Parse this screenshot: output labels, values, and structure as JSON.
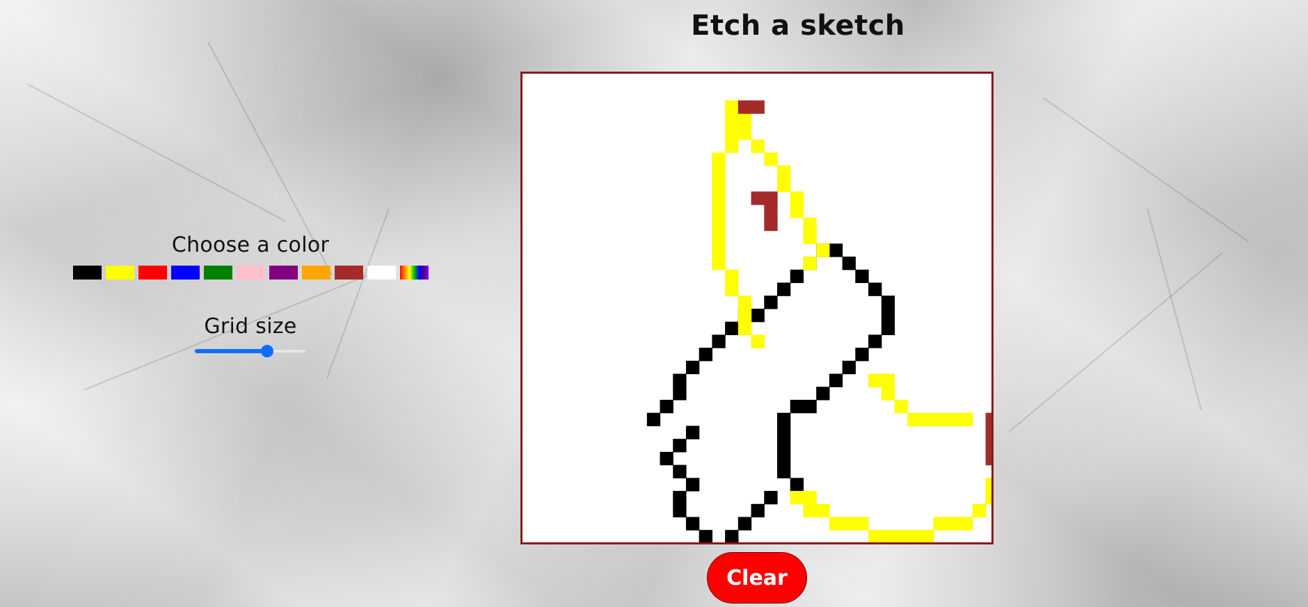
{
  "title": "Etch a sketch",
  "controls": {
    "color_heading": "Choose a color",
    "grid_heading": "Grid size",
    "grid_size_fraction": 0.65,
    "palette": [
      {
        "name": "black",
        "color": "#000000"
      },
      {
        "name": "yellow",
        "color": "#ffff00"
      },
      {
        "name": "red",
        "color": "#ff0000"
      },
      {
        "name": "blue",
        "color": "#0000ff"
      },
      {
        "name": "green",
        "color": "#008000"
      },
      {
        "name": "pink",
        "color": "#ffc0cb"
      },
      {
        "name": "purple",
        "color": "#800080"
      },
      {
        "name": "orange",
        "color": "#ffa500"
      },
      {
        "name": "brown",
        "color": "#a52a2a"
      },
      {
        "name": "white",
        "color": "#ffffff"
      },
      {
        "name": "rainbow",
        "color": "rainbow"
      }
    ]
  },
  "board": {
    "grid_size": 36,
    "colors": {
      "k": "#000000",
      "y": "#ffff00",
      "b": "#a52a2a"
    },
    "painted": {
      "k": [
        [
          17,
          11
        ],
        [
          18,
          11
        ],
        [
          16,
          12
        ],
        [
          19,
          12
        ],
        [
          15,
          13
        ],
        [
          20,
          13
        ],
        [
          14,
          14
        ],
        [
          21,
          14
        ],
        [
          13,
          15
        ],
        [
          22,
          15
        ],
        [
          11,
          16
        ],
        [
          12,
          16
        ],
        [
          22,
          16
        ],
        [
          10,
          17
        ],
        [
          22,
          17
        ],
        [
          9,
          18
        ],
        [
          21,
          18
        ],
        [
          8,
          19
        ],
        [
          20,
          19
        ],
        [
          7,
          20
        ],
        [
          19,
          20
        ],
        [
          6,
          21
        ],
        [
          18,
          21
        ],
        [
          6,
          22
        ],
        [
          17,
          22
        ],
        [
          5,
          23
        ],
        [
          15,
          23
        ],
        [
          16,
          23
        ],
        [
          4,
          24
        ],
        [
          14,
          24
        ],
        [
          7,
          25
        ],
        [
          14,
          25
        ],
        [
          6,
          26
        ],
        [
          14,
          26
        ],
        [
          5,
          27
        ],
        [
          14,
          27
        ],
        [
          6,
          28
        ],
        [
          14,
          28
        ],
        [
          7,
          29
        ],
        [
          15,
          29
        ],
        [
          6,
          30
        ],
        [
          13,
          30
        ],
        [
          6,
          31
        ],
        [
          12,
          31
        ],
        [
          7,
          32
        ],
        [
          11,
          32
        ],
        [
          8,
          33
        ],
        [
          10,
          33
        ]
      ],
      "y": [
        [
          10,
          0
        ],
        [
          10,
          1
        ],
        [
          11,
          1
        ],
        [
          10,
          2
        ],
        [
          11,
          2
        ],
        [
          10,
          3
        ],
        [
          12,
          3
        ],
        [
          9,
          4
        ],
        [
          13,
          4
        ],
        [
          9,
          5
        ],
        [
          14,
          5
        ],
        [
          9,
          6
        ],
        [
          14,
          6
        ],
        [
          9,
          7
        ],
        [
          15,
          7
        ],
        [
          9,
          8
        ],
        [
          15,
          8
        ],
        [
          9,
          9
        ],
        [
          16,
          9
        ],
        [
          9,
          10
        ],
        [
          16,
          10
        ],
        [
          9,
          11
        ],
        [
          17,
          11
        ],
        [
          9,
          12
        ],
        [
          16,
          12
        ],
        [
          10,
          13
        ],
        [
          10,
          14
        ],
        [
          11,
          15
        ],
        [
          11,
          16
        ],
        [
          11,
          17
        ],
        [
          12,
          18
        ],
        [
          21,
          21
        ],
        [
          22,
          21
        ],
        [
          22,
          22
        ],
        [
          23,
          23
        ],
        [
          24,
          24
        ],
        [
          25,
          24
        ],
        [
          26,
          24
        ],
        [
          27,
          24
        ],
        [
          28,
          24
        ],
        [
          15,
          30
        ],
        [
          16,
          30
        ],
        [
          16,
          31
        ],
        [
          17,
          31
        ],
        [
          18,
          32
        ],
        [
          19,
          32
        ],
        [
          20,
          32
        ],
        [
          21,
          33
        ],
        [
          22,
          33
        ],
        [
          23,
          33
        ],
        [
          24,
          33
        ],
        [
          25,
          33
        ],
        [
          26,
          32
        ],
        [
          27,
          32
        ],
        [
          28,
          32
        ],
        [
          29,
          31
        ],
        [
          30,
          30
        ],
        [
          30,
          29
        ]
      ],
      "b": [
        [
          11,
          0
        ],
        [
          12,
          0
        ],
        [
          12,
          7
        ],
        [
          13,
          7
        ],
        [
          13,
          8
        ],
        [
          13,
          9
        ],
        [
          30,
          24
        ],
        [
          30,
          25
        ],
        [
          30,
          26
        ],
        [
          30,
          27
        ]
      ]
    }
  },
  "clear_label": "Clear"
}
